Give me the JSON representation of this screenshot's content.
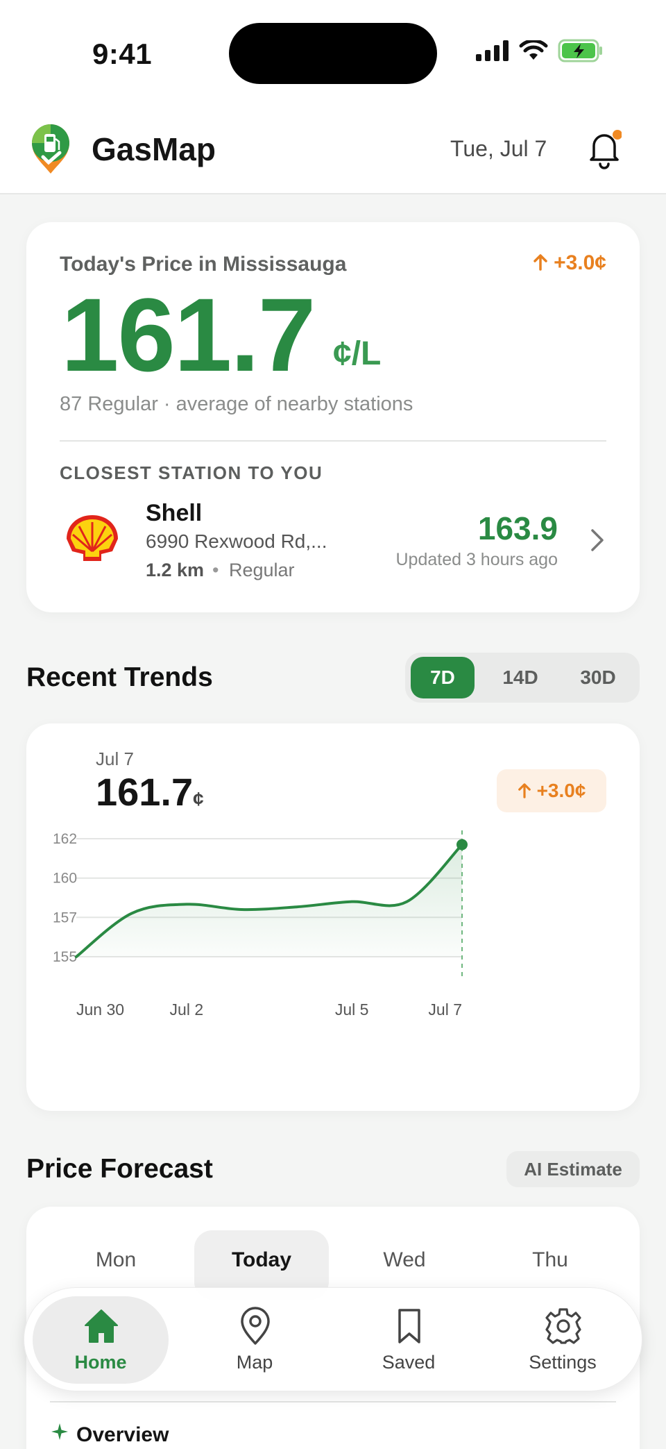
{
  "status_bar": {
    "time": "9:41"
  },
  "header": {
    "app_name": "GasMap",
    "date": "Tue, Jul 7"
  },
  "price_card": {
    "label": "Today's Price in Mississauga",
    "change": "+3.0¢",
    "price": "161.7",
    "unit": "¢/L",
    "subtitle": "87 Regular · average of nearby stations",
    "closest_label": "CLOSEST STATION TO YOU",
    "station": {
      "name": "Shell",
      "address": "6990 Rexwood Rd,...",
      "distance": "1.2 km",
      "separator": "•",
      "grade": "Regular",
      "price": "163.9",
      "updated": "Updated 3 hours ago"
    }
  },
  "trends": {
    "title": "Recent Trends",
    "ranges": [
      "7D",
      "14D",
      "30D"
    ],
    "active_range": "7D",
    "selected_date": "Jul 7",
    "selected_value": "161.7",
    "selected_unit": "¢",
    "change": "+3.0¢"
  },
  "chart_data": {
    "type": "area",
    "x_tick_labels": [
      "Jun 30",
      "Jul 2",
      "Jul 5",
      "Jul 7"
    ],
    "y_tick_labels": [
      "162",
      "160",
      "157",
      "155"
    ],
    "ylim": [
      155,
      162
    ],
    "grid": true,
    "x": [
      "Jun 30",
      "Jul 1",
      "Jul 2",
      "Jul 3",
      "Jul 4",
      "Jul 5",
      "Jul 6",
      "Jul 7"
    ],
    "values": [
      155,
      157.3,
      158.0,
      157.6,
      157.8,
      158.2,
      158.2,
      161.7
    ],
    "color": "#2a8a43"
  },
  "forecast": {
    "title": "Price Forecast",
    "chip": "AI Estimate",
    "days": [
      "Mon",
      "Today",
      "Wed",
      "Thu"
    ],
    "overview_label": "Overview"
  },
  "tabbar": {
    "tabs": [
      {
        "label": "Home",
        "icon": "home-icon",
        "active": true
      },
      {
        "label": "Map",
        "icon": "map-pin-icon",
        "active": false
      },
      {
        "label": "Saved",
        "icon": "bookmark-icon",
        "active": false
      },
      {
        "label": "Settings",
        "icon": "gear-icon",
        "active": false
      }
    ]
  },
  "colors": {
    "brand_green": "#2a8a43",
    "accent_orange": "#e8801f"
  }
}
